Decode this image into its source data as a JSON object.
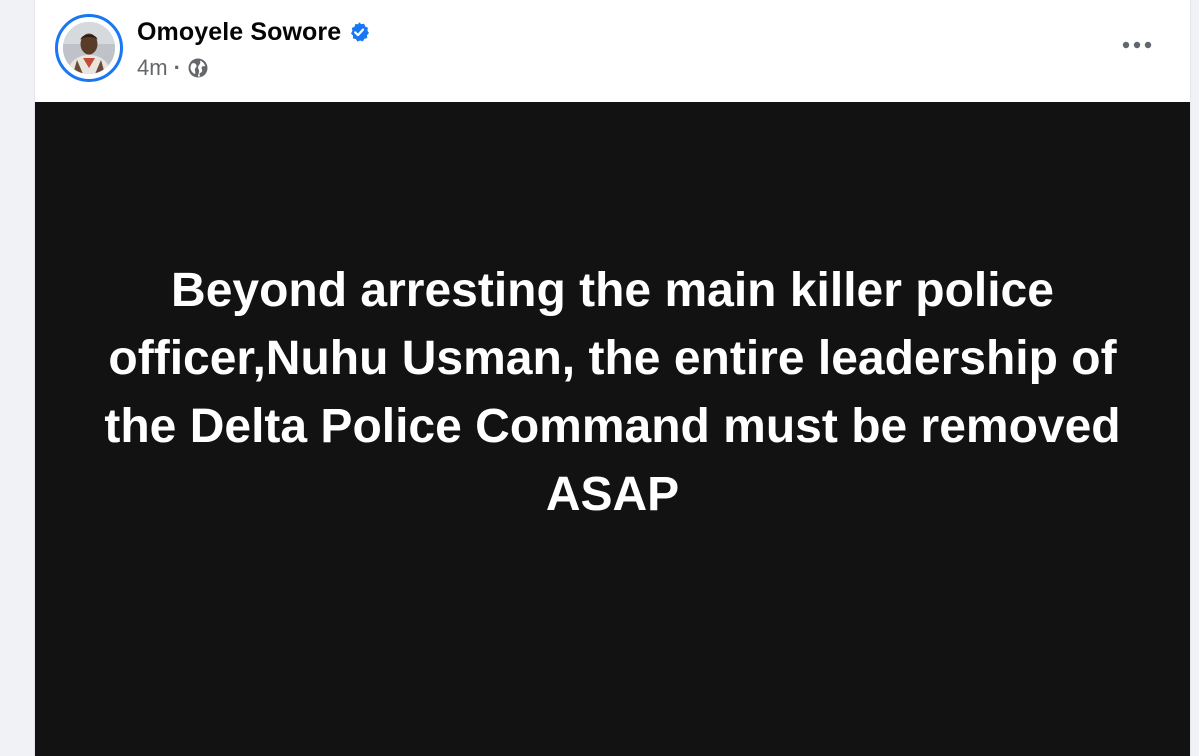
{
  "post": {
    "author": {
      "name": "Omoyele Sowore",
      "avatar_icon": "profile-photo",
      "verified_icon": "verified-badge-icon",
      "verified_color": "#1877f2"
    },
    "meta": {
      "time": "4m",
      "separator": "·",
      "audience_icon": "globe-icon"
    },
    "menu_icon": "more-options-icon",
    "content": {
      "text": "Beyond arresting the main killer police officer,Nuhu Usman, the entire leadership of the Delta Police Command must be removed ASAP",
      "background_color": "#121212",
      "text_color": "#ffffff"
    }
  }
}
